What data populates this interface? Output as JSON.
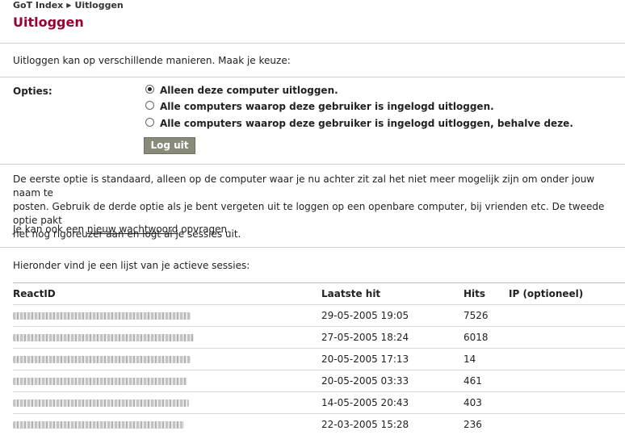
{
  "breadcrumb": {
    "home": "GoT Index",
    "current": "Uitloggen"
  },
  "page_title": "Uitloggen",
  "intro": "Uitloggen kan op verschillende manieren. Maak je keuze:",
  "options": {
    "label": "Opties:",
    "items": [
      {
        "label": "Alleen deze computer uitloggen.",
        "selected": true
      },
      {
        "label": "Alle computers waarop deze gebruiker is ingelogd uitloggen.",
        "selected": false
      },
      {
        "label": "Alle computers waarop deze gebruiker is ingelogd uitloggen, behalve deze.",
        "selected": false
      }
    ],
    "submit": "Log uit"
  },
  "explanation": {
    "line1": "De eerste optie is standaard, alleen op de computer waar je nu achter zit zal het niet meer mogelijk zijn om onder jouw naam te",
    "line2": "posten. Gebruik de derde optie als je bent vergeten uit te loggen op een openbare computer, bij vrienden etc. De tweede optie pakt",
    "line3": "het nog rigoreuzer aan en logt al je sessies uit."
  },
  "password": {
    "before": "Je kan ook een ",
    "link": "nieuw wachtwoord",
    "after": " opvragen."
  },
  "sessions_intro": "Hieronder vind je een lijst van je actieve sessies:",
  "sessions": {
    "headers": [
      "ReactID",
      "Laatste hit",
      "Hits",
      "IP (optioneel)"
    ],
    "rows": [
      {
        "last_hit": "29-05-2005 19:05",
        "hits": "7526",
        "ip": ""
      },
      {
        "last_hit": "27-05-2005 18:24",
        "hits": "6018",
        "ip": ""
      },
      {
        "last_hit": "20-05-2005 17:13",
        "hits": "14",
        "ip": ""
      },
      {
        "last_hit": "20-05-2005 03:33",
        "hits": "461",
        "ip": ""
      },
      {
        "last_hit": "14-05-2005 20:43",
        "hits": "403",
        "ip": ""
      },
      {
        "last_hit": "22-03-2005 15:28",
        "hits": "236",
        "ip": ""
      }
    ]
  },
  "colors": {
    "title": "#990033",
    "button": "#8a8a7a"
  }
}
